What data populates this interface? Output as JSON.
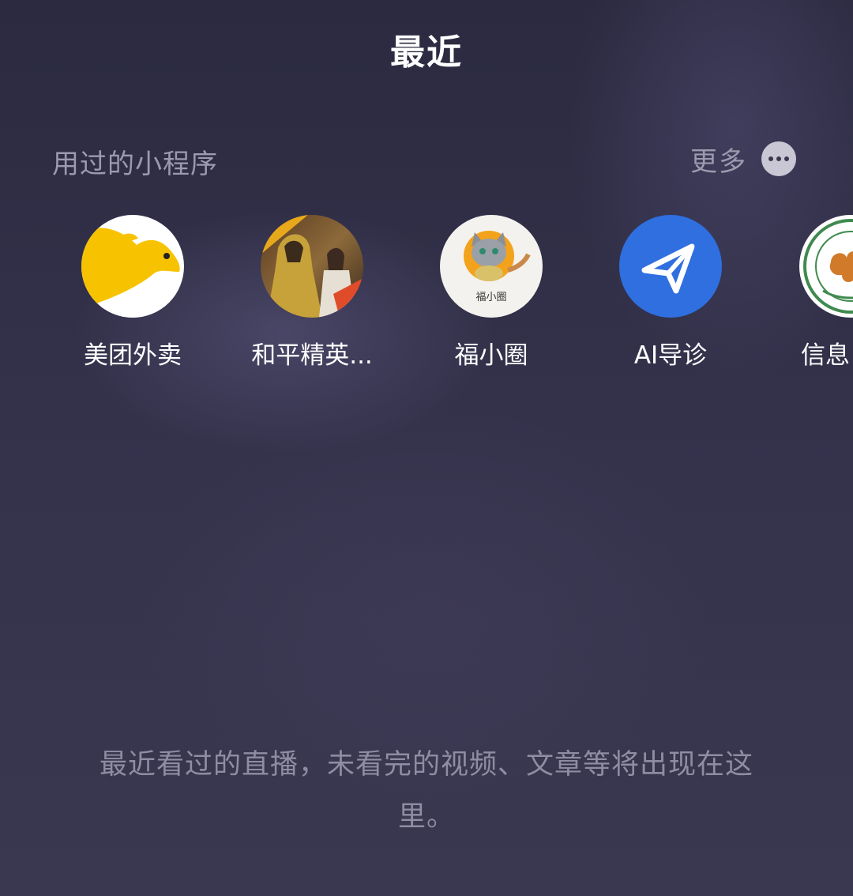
{
  "header": {
    "title": "最近"
  },
  "mini_programs": {
    "section_title": "用过的小程序",
    "more_label": "更多",
    "more_icon": "more-dots-icon",
    "items": [
      {
        "label": "美团外卖",
        "icon": "meituan-kangaroo-icon",
        "color": "#f7c300"
      },
      {
        "label": "和平精英...",
        "icon": "peace-elite-game-icon",
        "color": "#b58a35"
      },
      {
        "label": "福小圈",
        "icon": "cat-logo-icon",
        "icon_text": "福小圈",
        "color": "#f3a21b"
      },
      {
        "label": "AI导诊",
        "icon": "paper-plane-icon",
        "color": "#2f6fe0"
      },
      {
        "label": "信息",
        "icon": "hospital-seal-icon",
        "color": "#3f8a4f"
      }
    ]
  },
  "empty_state": {
    "message": "最近看过的直播，未看完的视频、文章等将出现在这里。"
  }
}
